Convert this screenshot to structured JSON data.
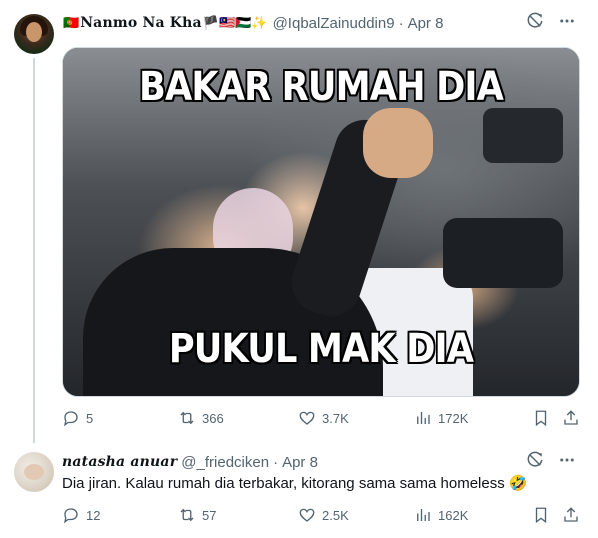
{
  "tweet": {
    "display_name": "Nanmo Na Kha",
    "name_flags_left": "🇵🇹",
    "name_flags_right": "🏴🇲🇾🇵🇸✨",
    "handle": "@IqbalZainuddin9",
    "separator": "·",
    "date": "Apr 8",
    "image_caption_top": "BAKAR RUMAH DIA",
    "image_caption_bottom": "PUKUL MAK DIA",
    "stats": {
      "replies": "5",
      "retweets": "366",
      "likes": "3.7K",
      "views": "172K"
    }
  },
  "reply": {
    "display_name": "natasha anuar",
    "handle": "@_friedciken",
    "separator": "·",
    "date": "Apr 8",
    "text": "Dia jiran. Kalau rumah dia terbakar, kitorang sama sama homeless 🤣",
    "stats": {
      "replies": "12",
      "retweets": "57",
      "likes": "2.5K",
      "views": "162K"
    }
  },
  "icons": {
    "grok": "grok-slash-icon",
    "more": "more-dots-icon",
    "reply": "reply-bubble-icon",
    "retweet": "retweet-arrows-icon",
    "like": "heart-icon",
    "views": "views-bars-icon",
    "bookmark": "bookmark-icon",
    "share": "share-upload-icon"
  },
  "colors": {
    "text": "#0f1419",
    "muted": "#536471",
    "border": "#cfd9de"
  }
}
